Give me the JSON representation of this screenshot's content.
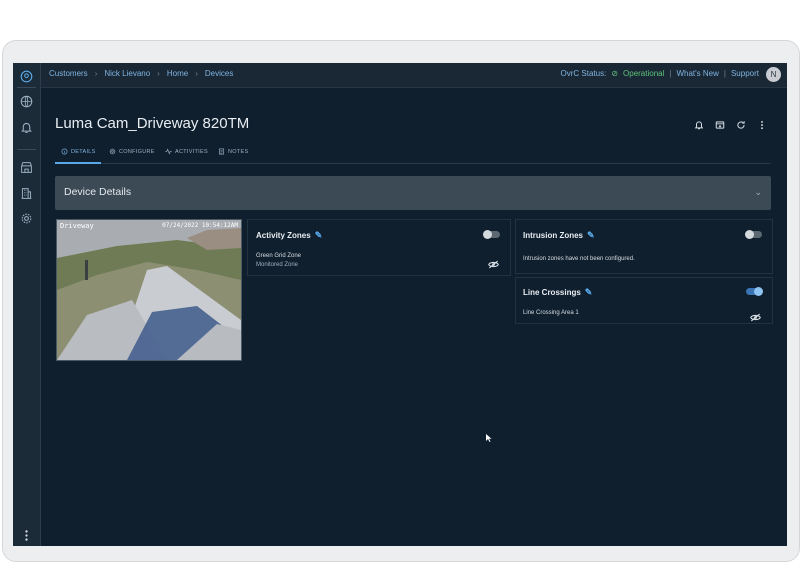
{
  "breadcrumb": [
    "Customers",
    "Nick Lievano",
    "Home",
    "Devices"
  ],
  "status": {
    "label": "OvrC Status:",
    "value": "Operational",
    "whats_new": "What's New",
    "support": "Support"
  },
  "user": {
    "initial": "N"
  },
  "page": {
    "title": "Luma Cam_Driveway 820TM"
  },
  "tabs": [
    {
      "label": "DETAILS",
      "icon": "info-icon"
    },
    {
      "label": "CONFIGURE",
      "icon": "settings-icon"
    },
    {
      "label": "ACTIVITIES",
      "icon": "activity-icon"
    },
    {
      "label": "NOTES",
      "icon": "notes-icon"
    }
  ],
  "device_details": {
    "title": "Device Details"
  },
  "camera": {
    "name": "Driveway",
    "timestamp": "07/24/2022 10:54:12AM"
  },
  "activity_zones": {
    "title": "Activity Zones",
    "enabled": false,
    "item_name": "Green Grid Zone",
    "item_type": "Monitored Zone"
  },
  "intrusion_zones": {
    "title": "Intrusion Zones",
    "enabled": false,
    "empty_message": "Intrusion zones have not been configured."
  },
  "line_crossings": {
    "title": "Line Crossings",
    "enabled": true,
    "item_name": "Line Crossing Area 1"
  },
  "colors": {
    "background": "#0f1f2e",
    "accent": "#5aa8e8",
    "operational": "#5ec27a"
  }
}
